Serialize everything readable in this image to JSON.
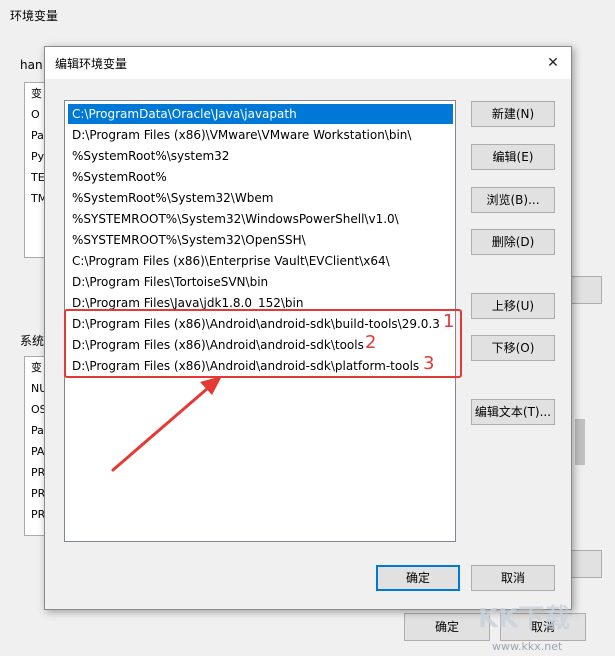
{
  "background": {
    "title": "环境变量",
    "user_group_label": "han",
    "user_list": [
      "变",
      "O",
      "Pa",
      "Py",
      "TE",
      "TM"
    ],
    "system_group_label": "系统",
    "system_list": [
      "变",
      "NU",
      "OS",
      "Pa",
      "PA",
      "PR",
      "PR",
      "PR"
    ],
    "ok_label": "确定",
    "cancel_label": "取消"
  },
  "dialog": {
    "title": "编辑环境变量",
    "close_glyph": "✕",
    "paths": [
      "C:\\ProgramData\\Oracle\\Java\\javapath",
      "D:\\Program Files (x86)\\VMware\\VMware Workstation\\bin\\",
      "%SystemRoot%\\system32",
      "%SystemRoot%",
      "%SystemRoot%\\System32\\Wbem",
      "%SYSTEMROOT%\\System32\\WindowsPowerShell\\v1.0\\",
      "%SYSTEMROOT%\\System32\\OpenSSH\\",
      "C:\\Program Files (x86)\\Enterprise Vault\\EVClient\\x64\\",
      "D:\\Program Files\\TortoiseSVN\\bin",
      "D:\\Program Files\\Java\\jdk1.8.0_152\\bin",
      "D:\\Program Files (x86)\\Android\\android-sdk\\build-tools\\29.0.3",
      "D:\\Program Files (x86)\\Android\\android-sdk\\tools",
      "D:\\Program Files (x86)\\Android\\android-sdk\\platform-tools"
    ],
    "buttons": {
      "new": "新建(N)",
      "edit": "编辑(E)",
      "browse": "浏览(B)...",
      "delete": "删除(D)",
      "move_up": "上移(U)",
      "move_down": "下移(O)",
      "edit_text": "编辑文本(T)...",
      "ok": "确定",
      "cancel": "取消"
    }
  },
  "annotations": {
    "n1": "1",
    "n2": "2",
    "n3": "3"
  },
  "watermark": {
    "text": "KK下载",
    "url": "www.kkx.net"
  },
  "colors": {
    "selection": "#0078d7",
    "annotation": "#e53935"
  }
}
